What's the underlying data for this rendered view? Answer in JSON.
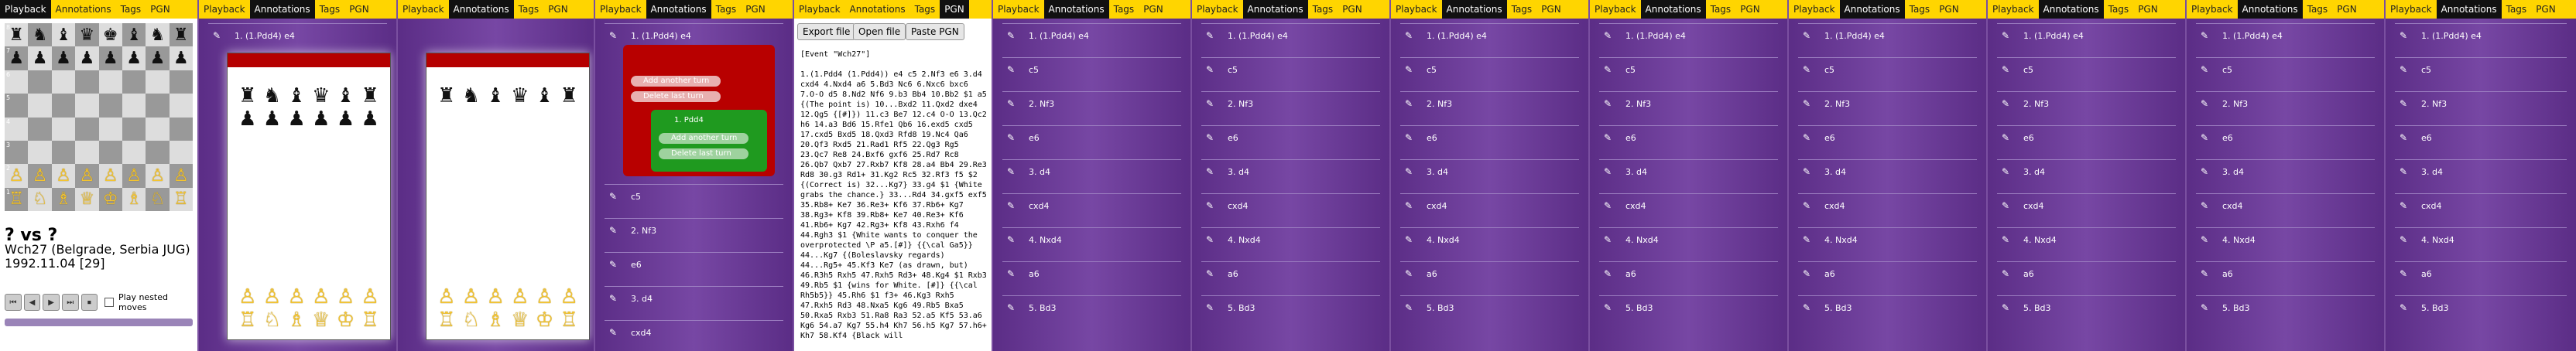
{
  "tabs": [
    "Playback",
    "Annotations",
    "Tags",
    "PGN"
  ],
  "board": {
    "ranks": [
      "8",
      "7",
      "6",
      "5",
      "4",
      "3",
      "2",
      "1"
    ],
    "rows": [
      [
        "♜",
        "♞",
        "♝",
        "♛",
        "♚",
        "♝",
        "♞",
        "♜"
      ],
      [
        "♟",
        "♟",
        "♟",
        "♟",
        "♟",
        "♟",
        "♟",
        "♟"
      ],
      [
        "",
        "",
        "",
        "",
        "",
        "",
        "",
        ""
      ],
      [
        "",
        "",
        "",
        "",
        "",
        "",
        "",
        ""
      ],
      [
        "",
        "",
        "",
        "",
        "",
        "",
        "",
        ""
      ],
      [
        "",
        "",
        "",
        "",
        "",
        "",
        "",
        ""
      ],
      [
        "♙",
        "♙",
        "♙",
        "♙",
        "♙",
        "♙",
        "♙",
        "♙"
      ],
      [
        "♖",
        "♘",
        "♗",
        "♕",
        "♔",
        "♗",
        "♘",
        "♖"
      ]
    ]
  },
  "game": {
    "players": "? vs ?",
    "event": "Wch27 (Belgrade, Serbia JUG)",
    "date": "1992.11.04 [29]"
  },
  "controls": {
    "buttons": [
      "⏮",
      "◀",
      "▶",
      "⏭",
      "⏹"
    ],
    "nested_label": "Play nested moves"
  },
  "moves": {
    "first": "1. (1.Pdd4) e4",
    "list": [
      "1. (1.Pdd4) e4",
      "c5",
      "2. Nf3",
      "e6",
      "3. d4",
      "cxd4",
      "4. Nxd4",
      "a6",
      "5. Bd3"
    ]
  },
  "annotations": {
    "add_another": "Add another turn",
    "delete_last": "Delete last turn",
    "variation": "1. Pdd4"
  },
  "pgn": {
    "export": "Export file",
    "open": "Open file",
    "paste": "Paste PGN",
    "text": "[Event \"Wch27\"]\n\n1.(1.Pdd4 (1.Pdd4)) e4 c5 2.Nf3 e6 3.d4 cxd4 4.Nxd4 a6 5.Bd3 Nc6 6.Nxc6 bxc6 7.O-O d5 8.Nd2 Nf6 9.b3 Bb4 10.Bb2 $1 a5 {(The point is) 10...Bxd2 11.Qxd2 dxe4 12.Qg5 {[#]}) 11.c3 Be7 12.c4 O-O 13.Qc2 h6 14.a3 Bd6 15.Rfe1 Qb6 16.exd5 cxd5 17.cxd5 Bxd5 18.Qxd3 Rfd8 19.Nc4 Qa6 20.Qf3 Rxd5 21.Rad1 Rf5 22.Qg3 Rg5 23.Qc7 Re8 24.Bxf6 gxf6 25.Rd7 Rc8 26.Qb7 Qxb7 27.Rxb7 Kf8 28.a4 Bb4 29.Re3 Rd8 30.g3 Rd1+ 31.Kg2 Rc5 32.Rf3 f5 $2 {(Correct is) 32...Kg7} 33.g4 $1 {White grabs the chance.} 33...Rd4 34.gxf5 exf5 35.Rb8+ Ke7 36.Re3+ Kf6 37.Rb6+ Kg7 38.Rg3+ Kf8 39.Rb8+ Ke7 40.Re3+ Kf6 41.Rb6+ Kg7 42.Rg3+ Kf8 43.Rxh6 f4 44.Rgh3 $1 {White wants to conquer the overprotected \\P a5.[#]} {{\\cal Ga5}} 44...Kg7 {(Boleslavsky regards) 44...Rg5+ 45.Kf3 Ke7 (as drawn, but) 46.R3h5 Rxh5 47.Rxh5 Rd3+ 48.Kg4 $1 Rxb3 49.Rb5 $1 {wins for White. [#]} {{\\cal Rh5b5}} 45.Rh6 $1 f3+ 46.Kg3 Rxh5 47.Rxh5 Rd3 48.Nxa5 Kg6 49.Rb5 Bxa5 50.Rxa5 Rxb3 51.Ra8 Ra3 52.a5 Kf5 53.a6 Kg6 54.a7 Kg7 55.h4 Kh7 56.h5 Kg7 57.h6+ Kh7 58.Kf4 {Black will"
  },
  "colors": {
    "tabbar": "#ffd500",
    "purple": "#6a3a96",
    "red": "#b80000",
    "green": "#1f9a1f",
    "gold": "#f4c430"
  }
}
